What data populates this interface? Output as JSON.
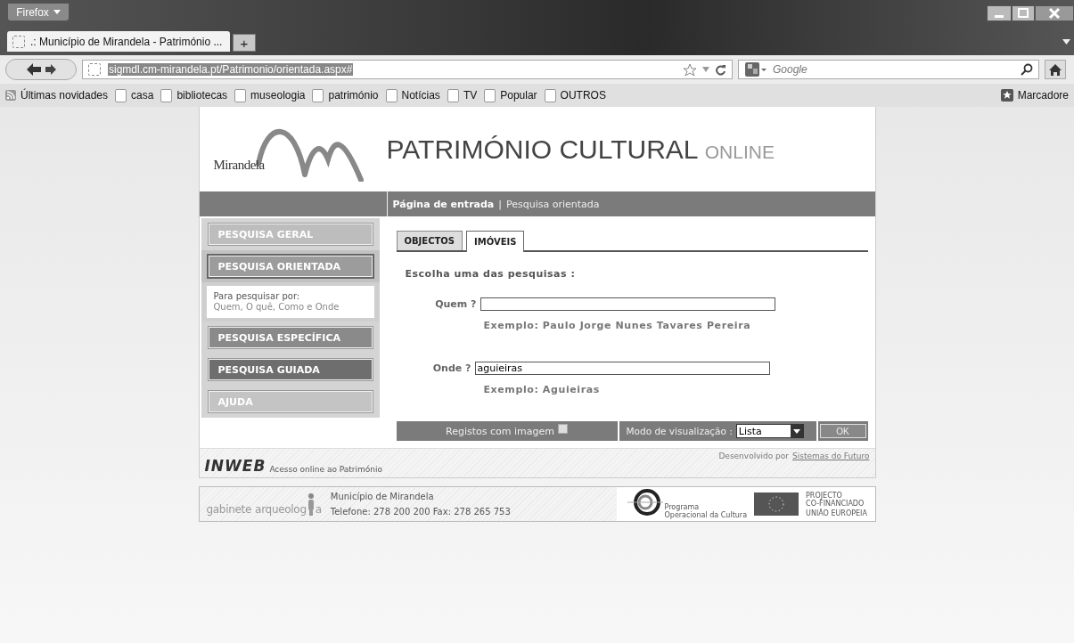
{
  "browser": {
    "menu_button": "Firefox",
    "tab_title": ".: Município de Mirandela - Património ...",
    "new_tab": "+",
    "url": "sigmdl.cm-mirandela.pt/Patrimonio/orientada.aspx#",
    "search_placeholder": "Google",
    "bookmarks": [
      "Últimas novidades",
      "casa",
      "bibliotecas",
      "museologia",
      "património",
      "Notícias",
      "TV",
      "Popular",
      "OUTROS"
    ],
    "bookmarks_menu": "Marcadore"
  },
  "header": {
    "logo_text": "Mirandela",
    "title": "PATRIMÓNIO CULTURAL",
    "title_suffix": "ONLINE"
  },
  "breadcrumb": {
    "current": "Página de entrada",
    "separator": "|",
    "page": "Pesquisa orientada"
  },
  "sidebar": [
    {
      "kind": "menu",
      "label": "PESQUISA GERAL",
      "selected": false,
      "color": "#bdbdbd"
    },
    {
      "kind": "menu",
      "label": "PESQUISA ORIENTADA",
      "selected": true,
      "color": "#9c9c9c"
    },
    {
      "kind": "info",
      "line1": "Para pesquisar por:",
      "line2": "Quem, O quê, Como e Onde"
    },
    {
      "kind": "menu",
      "label": "PESQUISA ESPECÍFICA",
      "selected": false,
      "color": "#8a8a8a"
    },
    {
      "kind": "menu",
      "label": "PESQUISA GUIADA",
      "selected": false,
      "color": "#6e6e6e"
    },
    {
      "kind": "menu",
      "label": "AJUDA",
      "selected": false,
      "color": "#c4c4c4"
    }
  ],
  "tabs": [
    {
      "label": "OBJECTOS",
      "selected": false
    },
    {
      "label": "IMÓVEIS",
      "selected": true
    }
  ],
  "form": {
    "heading": "Escolha uma das pesquisas :",
    "fields": [
      {
        "label": "Quem ?",
        "example": "Exemplo: Paulo Jorge Nunes Tavares Pereira"
      },
      {
        "label": "Onde ?",
        "value": "aguieiras",
        "example": "Exemplo: Aguieiras"
      }
    ]
  },
  "options": {
    "images_label": "Registos com imagem",
    "images_checked": false,
    "mode_label": "Modo de visualização :",
    "mode_value": "Lista",
    "ok": "OK"
  },
  "footer": {
    "brand": "INWEB",
    "brand_text": "Acesso online ao Património",
    "credit": "Desenvolvido por",
    "credit_link": "Sistemas do Futuro"
  },
  "partners": {
    "gabinete": "gabinete",
    "arqueolog": "arqueolog",
    "a": "a",
    "name": "Município de Mirandela",
    "contacts": "Telefone: 278 200 200 Fax: 278 265 753",
    "programa": "Programa",
    "programa_sub": "Operacional da Cultura",
    "projecto": "PROJECTO",
    "cofinanciado": "CO-FINANCIADO",
    "ue": "UNIÃO EUROPEIA"
  }
}
